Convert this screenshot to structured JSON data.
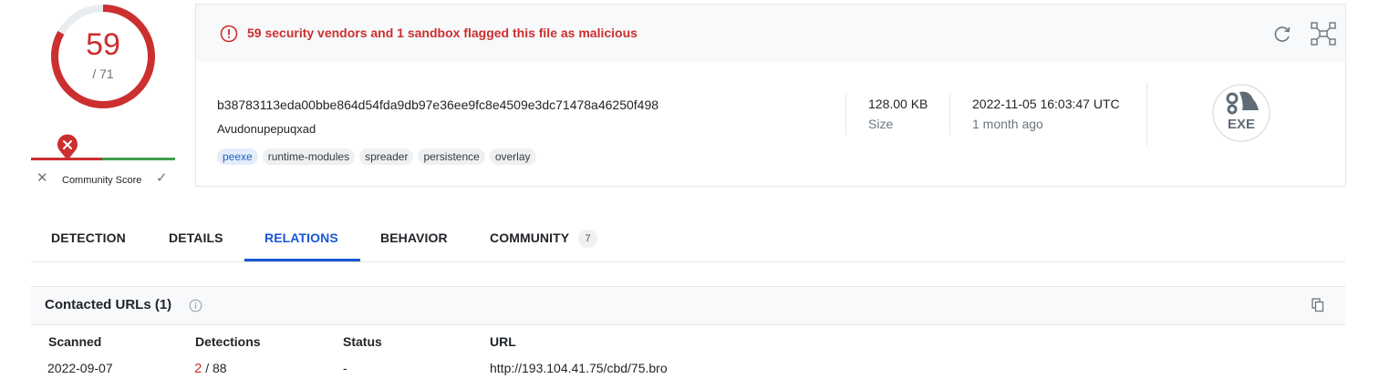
{
  "score": {
    "detections": "59",
    "total": "/ 71",
    "malicious_fraction": 0.831,
    "ring_color": "#cc2f2f"
  },
  "community": {
    "label": "Community Score",
    "negative_color": "#cc2f2f",
    "positive_color": "#3aa04a"
  },
  "alert": {
    "text": "59 security vendors and 1 sandbox flagged this file as malicious"
  },
  "file": {
    "hash": "b38783113eda00bbe864d54fda9db97e36ee9fc8e4509e3dc71478a46250f498",
    "name": "Avudonupepuqxad",
    "tags": [
      "peexe",
      "runtime-modules",
      "spreader",
      "persistence",
      "overlay"
    ],
    "size_value": "128.00 KB",
    "size_label": "Size",
    "date_value": "2022-11-05 16:03:47 UTC",
    "date_relative": "1 month ago",
    "type_icon_text": "EXE"
  },
  "tabs": [
    {
      "label": "DETECTION"
    },
    {
      "label": "DETAILS"
    },
    {
      "label": "RELATIONS",
      "active": true
    },
    {
      "label": "BEHAVIOR"
    },
    {
      "label": "COMMUNITY",
      "badge": "7"
    }
  ],
  "relations": {
    "title": "Contacted URLs (1)",
    "columns": [
      "Scanned",
      "Detections",
      "Status",
      "URL"
    ],
    "rows": [
      {
        "scanned": "2022-09-07",
        "det_positive": "2",
        "det_total": " / 88",
        "status": "-",
        "url": "http://193.104.41.75/cbd/75.bro"
      }
    ]
  },
  "colors": {
    "malicious": "#cc2f2f",
    "accent": "#1a56d6"
  }
}
